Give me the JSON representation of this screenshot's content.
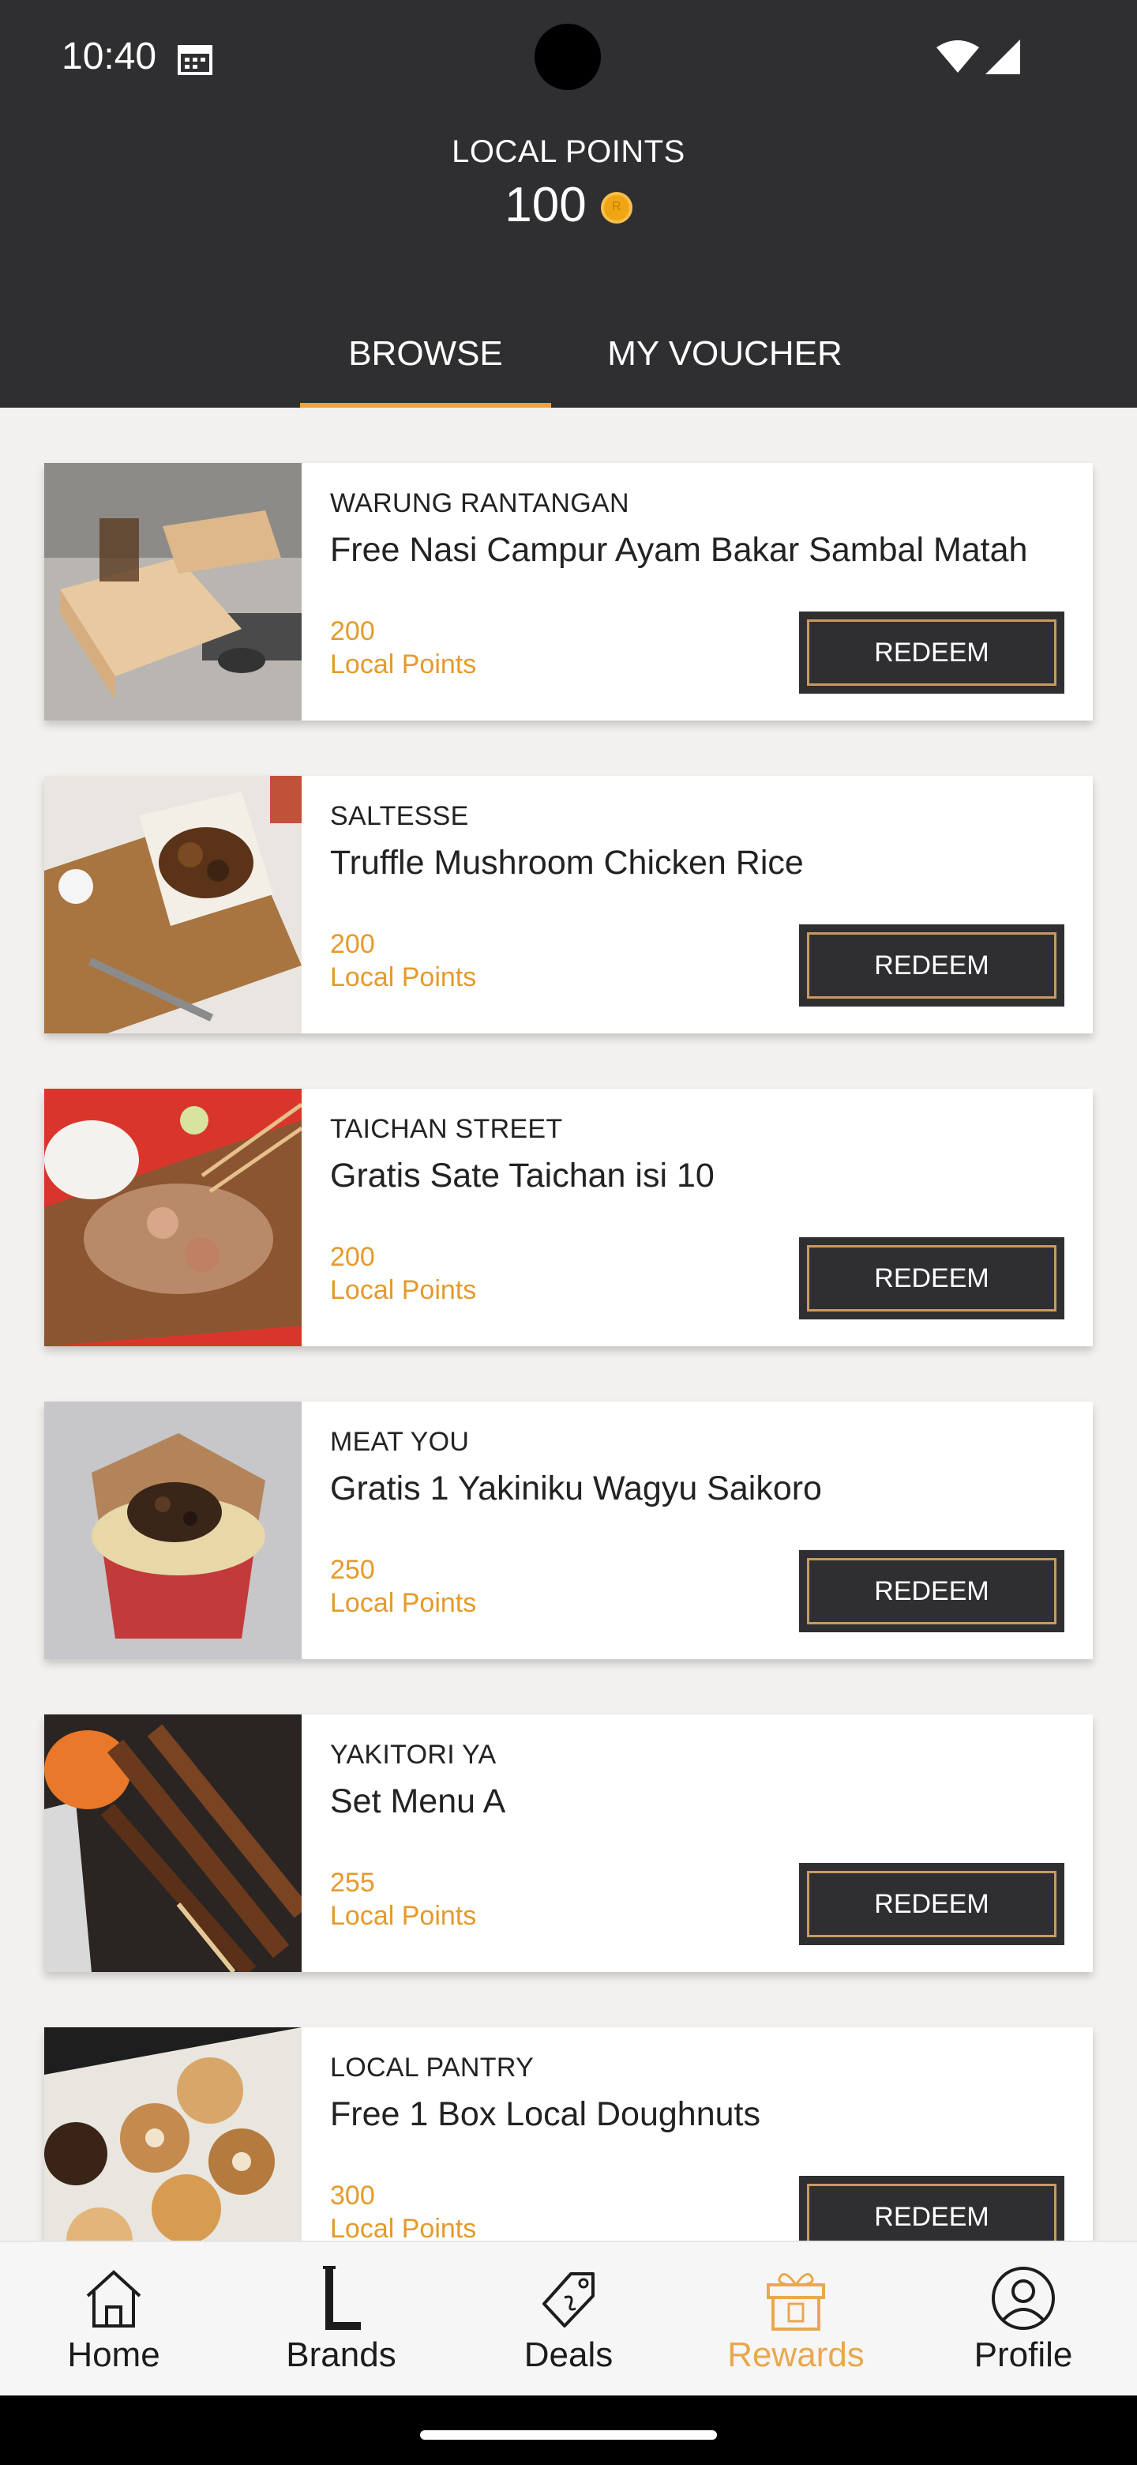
{
  "status_bar": {
    "time": "10:40"
  },
  "header": {
    "points_title": "LOCAL POINTS",
    "points_value": "100",
    "accent_color": "#f0a23b"
  },
  "tabs": [
    {
      "label": "BROWSE",
      "active": true
    },
    {
      "label": "MY VOUCHER",
      "active": false
    }
  ],
  "rewards": [
    {
      "brand": "WARUNG RANTANGAN",
      "title": "Free Nasi Campur Ayam Bakar Sambal Matah",
      "points": "200",
      "points_unit": "Local Points",
      "button": "REDEEM"
    },
    {
      "brand": "SALTESSE",
      "title": "Truffle Mushroom Chicken Rice",
      "points": "200",
      "points_unit": "Local Points",
      "button": "REDEEM"
    },
    {
      "brand": "TAICHAN STREET",
      "title": "Gratis Sate Taichan isi 10",
      "points": "200",
      "points_unit": "Local Points",
      "button": "REDEEM"
    },
    {
      "brand": "MEAT YOU",
      "title": "Gratis 1 Yakiniku Wagyu Saikoro",
      "points": "250",
      "points_unit": "Local Points",
      "button": "REDEEM"
    },
    {
      "brand": "YAKITORI YA",
      "title": "Set Menu A",
      "points": "255",
      "points_unit": "Local Points",
      "button": "REDEEM"
    },
    {
      "brand": "LOCAL PANTRY",
      "title": "Free 1 Box Local Doughnuts",
      "points": "300",
      "points_unit": "Local Points",
      "button": "REDEEM"
    }
  ],
  "bottom_nav": [
    {
      "label": "Home",
      "icon": "home-icon",
      "active": false
    },
    {
      "label": "Brands",
      "icon": "brands-icon",
      "active": false
    },
    {
      "label": "Deals",
      "icon": "deals-tag-icon",
      "active": false
    },
    {
      "label": "Rewards",
      "icon": "gift-icon",
      "active": true
    },
    {
      "label": "Profile",
      "icon": "profile-icon",
      "active": false
    }
  ]
}
